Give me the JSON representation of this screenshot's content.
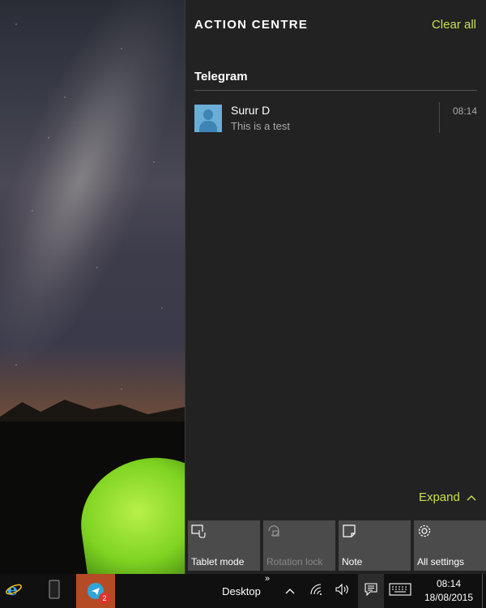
{
  "action_centre": {
    "title": "ACTION CENTRE",
    "clear_all": "Clear all",
    "groups": [
      {
        "app": "Telegram",
        "notifications": [
          {
            "sender": "Surur D",
            "message": "This is a test",
            "time": "08:14"
          }
        ]
      }
    ],
    "expand_label": "Expand",
    "quick_actions": [
      {
        "label": "Tablet mode",
        "icon": "tablet-mode-icon",
        "enabled": true
      },
      {
        "label": "Rotation lock",
        "icon": "rotation-lock-icon",
        "enabled": false
      },
      {
        "label": "Note",
        "icon": "note-icon",
        "enabled": true
      },
      {
        "label": "All settings",
        "icon": "gear-icon",
        "enabled": true
      }
    ],
    "accent_color": "#c9e04a"
  },
  "taskbar": {
    "apps": [
      {
        "name": "Internet Explorer",
        "icon": "internet-explorer-icon"
      },
      {
        "name": "Phone",
        "icon": "phone-icon"
      },
      {
        "name": "Telegram",
        "icon": "telegram-icon",
        "badge": "2",
        "active": true
      }
    ],
    "desktop_label": "Desktop",
    "desktop_arrow": "»",
    "clock": {
      "time": "08:14",
      "date": "18/08/2015"
    }
  }
}
